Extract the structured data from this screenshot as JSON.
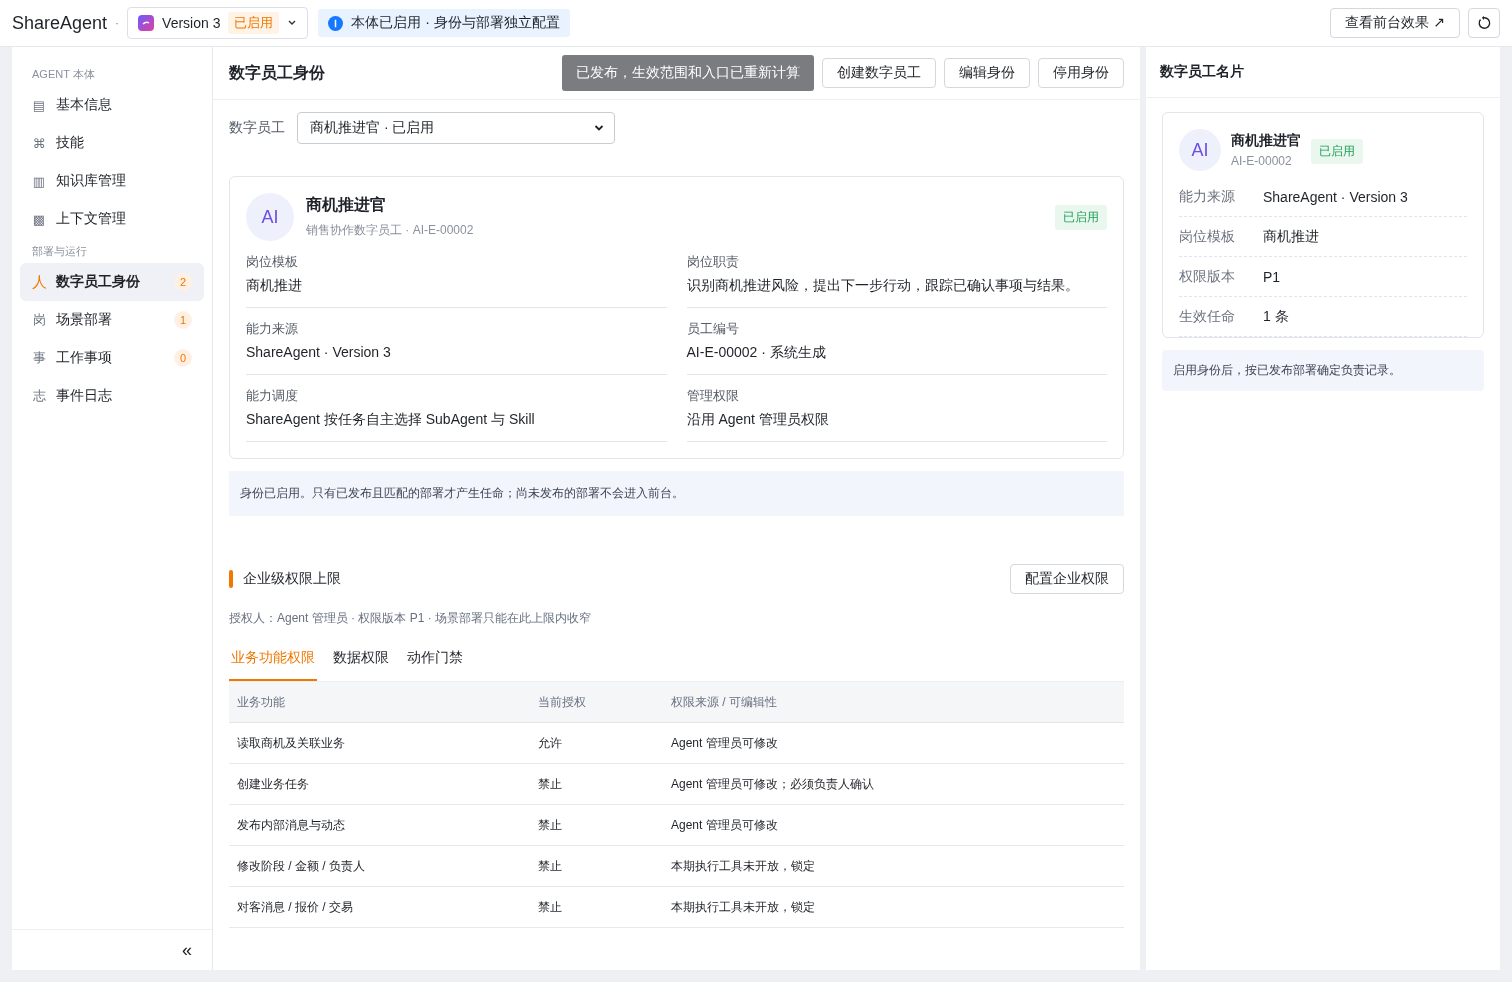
{
  "topbar": {
    "brand": "ShareAgent",
    "separator": "·",
    "version": {
      "label": "Version 3",
      "badge": "已启用"
    },
    "notice": "本体已启用 · 身份与部署独立配置",
    "preview_button": "查看前台效果 ↗"
  },
  "sidebar": {
    "sections": [
      {
        "title": "AGENT 本体",
        "items": [
          {
            "icon": "▤",
            "label": "基本信息",
            "selected": false
          },
          {
            "icon": "⌘",
            "label": "技能",
            "selected": false
          },
          {
            "icon": "▥",
            "label": "知识库管理",
            "selected": false
          },
          {
            "icon": "▩",
            "label": "上下文管理",
            "selected": false
          }
        ]
      },
      {
        "title": "部署与运行",
        "items": [
          {
            "icon": "人",
            "label": "数字员工身份",
            "selected": true,
            "count": "2"
          },
          {
            "icon": "岗",
            "label": "场景部署",
            "selected": false,
            "count": "1"
          },
          {
            "icon": "事",
            "label": "工作事项",
            "selected": false,
            "count": "0"
          },
          {
            "icon": "志",
            "label": "事件日志",
            "selected": false
          }
        ]
      }
    ],
    "collapse": "«"
  },
  "main": {
    "title": "数字员工身份",
    "toast": "已发布，生效范围和入口已重新计算",
    "actions": [
      "创建数字员工",
      "编辑身份",
      "停用身份"
    ],
    "selector": {
      "label": "数字员工",
      "value": "商机推进官 · 已启用"
    },
    "profile": {
      "avatar": "AI",
      "name": "商机推进官",
      "subtitle": "销售协作数字员工 · AI-E-00002",
      "status": "已启用",
      "fields": [
        {
          "label": "岗位模板",
          "value": "商机推进"
        },
        {
          "label": "岗位职责",
          "value": "识别商机推进风险，提出下一步行动，跟踪已确认事项与结果。"
        },
        {
          "label": "能力来源",
          "value": "ShareAgent · Version 3"
        },
        {
          "label": "员工编号",
          "value": "AI-E-00002 · 系统生成"
        },
        {
          "label": "能力调度",
          "value": "ShareAgent 按任务自主选择 SubAgent 与 Skill"
        },
        {
          "label": "管理权限",
          "value": "沿用 Agent 管理员权限"
        }
      ]
    },
    "info": "身份已启用。只有已发布且匹配的部署才产生任命；尚未发布的部署不会进入前台。",
    "permissions": {
      "title": "企业级权限上限",
      "button": "配置企业权限",
      "subtitle": "授权人：Agent 管理员 · 权限版本 P1 · 场景部署只能在此上限内收窄",
      "tabs": [
        {
          "label": "业务功能权限",
          "selected": true
        },
        {
          "label": "数据权限",
          "selected": false
        },
        {
          "label": "动作门禁",
          "selected": false
        }
      ],
      "table": {
        "columns": [
          "业务功能",
          "当前授权",
          "权限来源 / 可编辑性"
        ],
        "rows": [
          [
            "读取商机及关联业务",
            "允许",
            "Agent 管理员可修改"
          ],
          [
            "创建业务任务",
            "禁止",
            "Agent 管理员可修改；必须负责人确认"
          ],
          [
            "发布内部消息与动态",
            "禁止",
            "Agent 管理员可修改"
          ],
          [
            "修改阶段 / 金额 / 负责人",
            "禁止",
            "本期执行工具未开放，锁定"
          ],
          [
            "对客消息 / 报价 / 交易",
            "禁止",
            "本期执行工具未开放，锁定"
          ]
        ]
      }
    }
  },
  "card_panel": {
    "title": "数字员工名片",
    "avatar": "AI",
    "name": "商机推进官",
    "id": "AI-E-00002",
    "status": "已启用",
    "fields": [
      {
        "label": "能力来源",
        "value": "ShareAgent · Version 3"
      },
      {
        "label": "岗位模板",
        "value": "商机推进"
      },
      {
        "label": "权限版本",
        "value": "P1"
      },
      {
        "label": "生效任命",
        "value": "1 条"
      }
    ],
    "note": "启用身份后，按已发布部署确定负责记录。"
  }
}
